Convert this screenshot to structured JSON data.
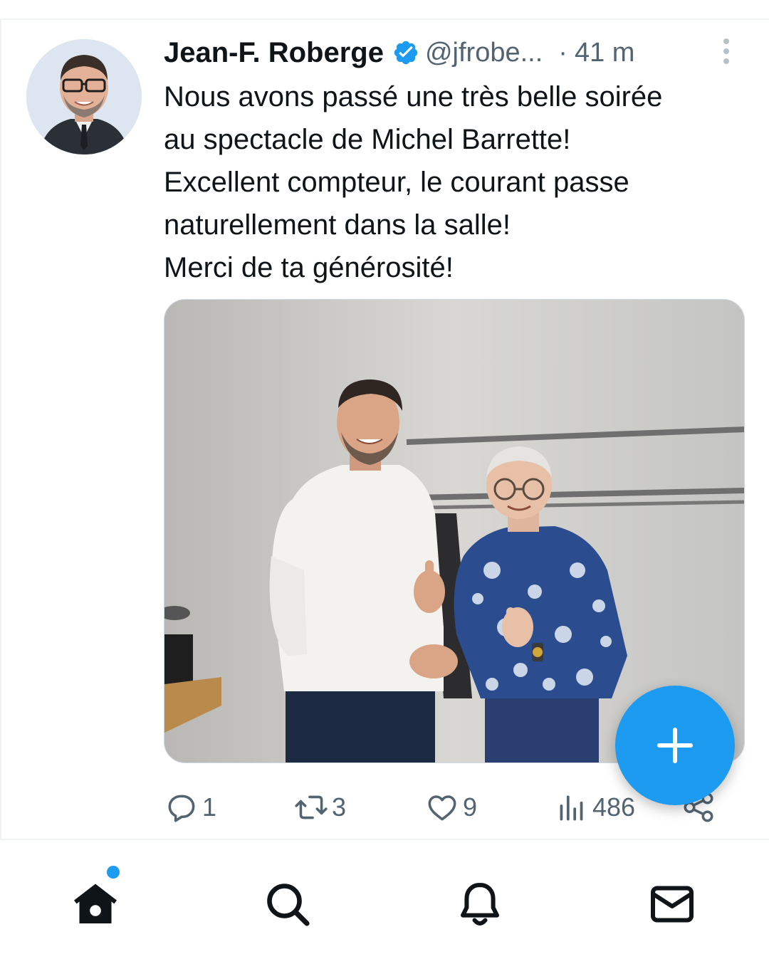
{
  "tweet": {
    "author_name": "Jean-F. Roberge",
    "handle": "@jfrobe...",
    "separator": "·",
    "time": "41 m",
    "text_lines": [
      "Nous avons passé une très belle soirée",
      "au spectacle de Michel Barrette!",
      "Excellent compteur, le courant passe",
      "naturellement dans la salle!",
      "Merci de ta générosité!"
    ]
  },
  "actions": {
    "reply_count": "1",
    "retweet_count": "3",
    "like_count": "9",
    "views_count": "486"
  },
  "icons": {
    "verified": "verified-badge-icon",
    "more": "more-vertical-icon",
    "reply": "reply-icon",
    "retweet": "retweet-icon",
    "like": "heart-icon",
    "views": "views-icon",
    "share": "share-icon",
    "compose": "plus-icon",
    "home": "home-icon",
    "search": "search-icon",
    "notifications": "bell-icon",
    "messages": "mail-icon"
  },
  "colors": {
    "accent": "#1d9bf0",
    "text": "#0f1419",
    "secondary": "#536471"
  }
}
